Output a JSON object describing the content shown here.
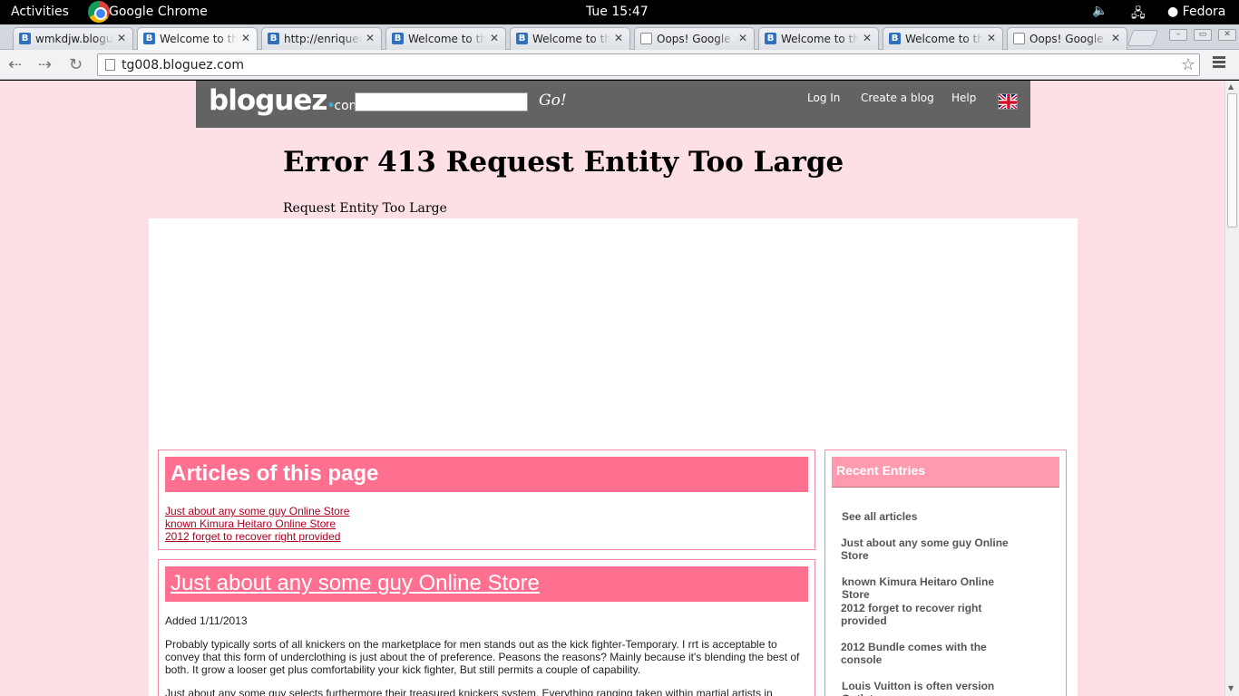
{
  "topbar": {
    "activities": "Activities",
    "app_name": "Google Chrome",
    "clock": "Tue 15:47",
    "user": "Fedora"
  },
  "tabs": [
    {
      "title": "wmkdjw.blogue",
      "icon": "bloguez-favicon"
    },
    {
      "title": "Welcome to the",
      "icon": "bloguez-favicon",
      "active": true
    },
    {
      "title": "http://enriqueni",
      "icon": "bloguez-favicon"
    },
    {
      "title": "Welcome to the",
      "icon": "bloguez-favicon"
    },
    {
      "title": "Welcome to the",
      "icon": "bloguez-favicon"
    },
    {
      "title": "Oops! Google C",
      "icon": "document-favicon"
    },
    {
      "title": "Welcome to the",
      "icon": "bloguez-favicon"
    },
    {
      "title": "Welcome to the",
      "icon": "bloguez-favicon"
    },
    {
      "title": "Oops! Google C",
      "icon": "document-favicon"
    }
  ],
  "omnibox": {
    "url": "tg008.bloguez.com"
  },
  "site": {
    "logo": "bloguez",
    "logo_suffix": "com",
    "go": "Go!",
    "nav": {
      "login": "Log In",
      "create": "Create a blog",
      "help": "Help"
    }
  },
  "error": {
    "title": "Error 413 Request Entity Too Large",
    "text": "Request Entity Too Large"
  },
  "articles_box": {
    "heading": "Articles of this page",
    "links": [
      "Just about any some guy Online Store",
      "known Kimura Heitaro Online Store",
      "2012 forget to recover right provided"
    ]
  },
  "post": {
    "title": "Just about any some guy Online Store",
    "date": "Added 1/11/2013",
    "para1": "Probably typically sorts of all knickers on the marketplace for men stands out as the kick fighter-Temporary. I rrt is acceptable to convey that this form of underclothing is just about the of preference. Peasons the reasons? Mainly because it's blending the best of both. It grow a looser get plus comfortability your kick fighter, But still permits a couple of capability.",
    "para2": "Just about any some guy selects furthermore their treasured knickers system. Everything ranging taken within martial artists in"
  },
  "sidebar": {
    "heading": "Recent Entries",
    "items": [
      "See all articles",
      "Just about any some guy Online Store",
      "known Kimura Heitaro Online Store",
      "2012 forget to recover right provided",
      "2012 Bundle comes with the console",
      "Louis Vuitton is often version Outlet"
    ]
  },
  "colors": {
    "page_bg": "#fde0e5",
    "header_bg": "#636363",
    "accent_pink": "#ff7090",
    "sidebar_pink": "#ff9aaf",
    "link_red": "#b00020"
  }
}
